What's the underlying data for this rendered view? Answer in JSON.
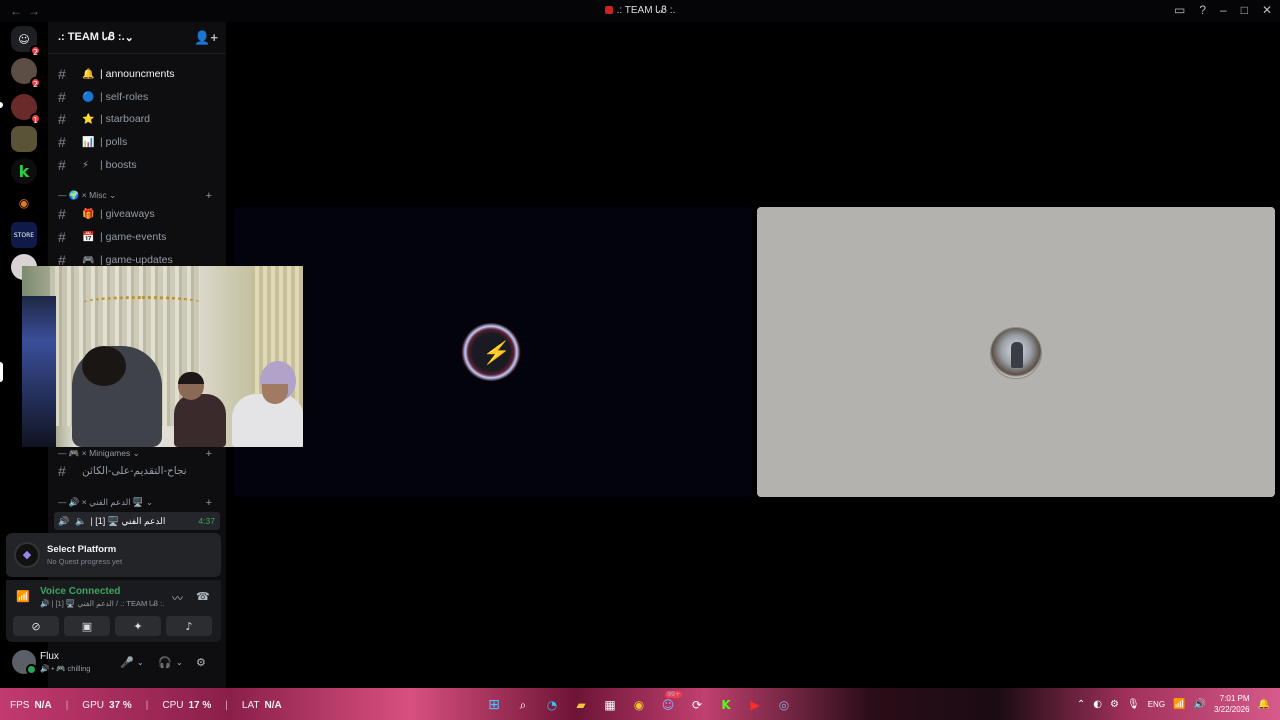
{
  "window": {
    "title": ".: TEAM ᏓᏰ :."
  },
  "guild_badges": {
    "g1": "2",
    "g2": "2",
    "g3": "1"
  },
  "server": {
    "name": ".: TEAM ᏓᏰ :."
  },
  "channels_top": [
    {
      "emoji": "🔔",
      "label": "| announcments"
    },
    {
      "emoji": "🔵",
      "label": "| self-roles"
    },
    {
      "emoji": "⭐",
      "label": "| starboard"
    },
    {
      "emoji": "📊",
      "label": "| polls"
    },
    {
      "emoji": "⚡",
      "label": "| boosts"
    }
  ],
  "cat_misc": "— 🌍 × Misc ⌄",
  "channels_misc": [
    {
      "emoji": "🎁",
      "label": "| giveaways"
    },
    {
      "emoji": "📅",
      "label": "| game-events"
    },
    {
      "emoji": "🎮",
      "label": "| game-updates"
    }
  ],
  "cat_minigames": "— 🎮 × Minigames ⌄",
  "channel_mini": "نجاح-التقديم-على-الكاثن",
  "cat_support": "— 🔊 × الدعم الفني 🖥️ ⌄",
  "voice_channel": {
    "label": "| [1] 🖥️ الدعم الفني",
    "time": "4:37"
  },
  "quest": {
    "title": "Select Platform",
    "subtitle": "No Quest progress yet"
  },
  "voice_connected": {
    "label": "Voice Connected",
    "sub": "🔊 | [1] 🖥️ الدعم الفني / .: TEAM ᏓᏰ :."
  },
  "user": {
    "name": "Flux",
    "status": "🔊 • 🎮 chilling"
  },
  "perf": {
    "fps_label": "FPS",
    "fps": "N/A",
    "gpu_label": "GPU",
    "gpu": "37 %",
    "cpu_label": "CPU",
    "cpu": "17 %",
    "lat_label": "LAT",
    "lat": "N/A"
  },
  "tray": {
    "lang": "ENG",
    "time": "7:01 PM",
    "date": "3/22/2026"
  },
  "taskbar_badge": "99+"
}
